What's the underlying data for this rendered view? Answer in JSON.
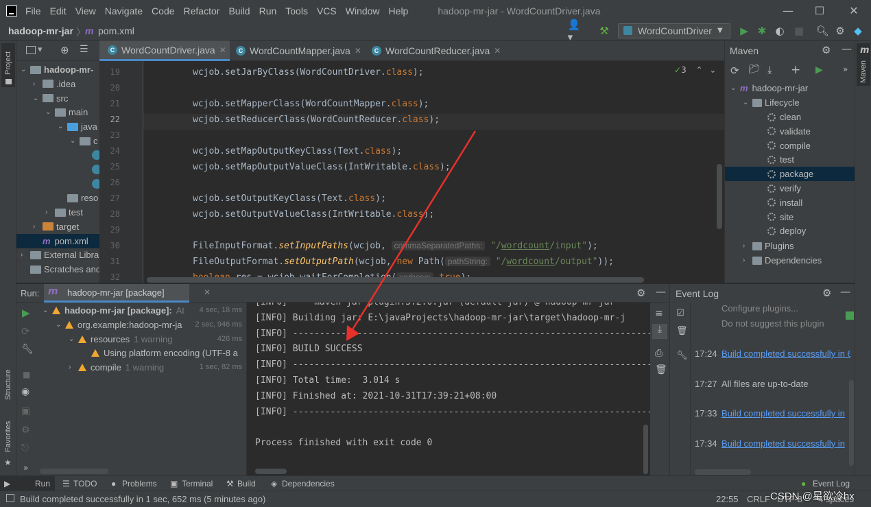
{
  "window": {
    "menu": [
      "File",
      "Edit",
      "View",
      "Navigate",
      "Code",
      "Refactor",
      "Build",
      "Run",
      "Tools",
      "VCS",
      "Window",
      "Help"
    ],
    "title": "hadoop-mr-jar - WordCountDriver.java"
  },
  "navbar": {
    "project": "hadoop-mr-jar",
    "separator": "〉",
    "file": "pom.xml",
    "run_config": "WordCountDriver"
  },
  "left_strip": {
    "project": "Project",
    "structure": "Structure",
    "favorites": "Favorites"
  },
  "project_tree": [
    {
      "label": "hadoop-mr-",
      "indent": 0,
      "arrow": "⌄",
      "kind": "project"
    },
    {
      "label": ".idea",
      "indent": 1,
      "arrow": "›",
      "kind": "folder"
    },
    {
      "label": "src",
      "indent": 1,
      "arrow": "⌄",
      "kind": "folder"
    },
    {
      "label": "main",
      "indent": 2,
      "arrow": "⌄",
      "kind": "folder"
    },
    {
      "label": "java",
      "indent": 3,
      "arrow": "⌄",
      "kind": "blue"
    },
    {
      "label": "c",
      "indent": 4,
      "arrow": "⌄",
      "kind": "package"
    },
    {
      "label": "",
      "indent": 5,
      "arrow": "",
      "kind": "class"
    },
    {
      "label": "",
      "indent": 5,
      "arrow": "",
      "kind": "class"
    },
    {
      "label": "",
      "indent": 5,
      "arrow": "",
      "kind": "class"
    },
    {
      "label": "reso",
      "indent": 3,
      "arrow": "",
      "kind": "folder"
    },
    {
      "label": "test",
      "indent": 2,
      "arrow": "›",
      "kind": "folder"
    },
    {
      "label": "target",
      "indent": 1,
      "arrow": "›",
      "kind": "orange"
    },
    {
      "label": "pom.xml",
      "indent": 1,
      "arrow": "",
      "kind": "maven"
    },
    {
      "label": "External Libra",
      "indent": 0,
      "arrow": "›",
      "kind": "lib"
    },
    {
      "label": "Scratches and",
      "indent": 0,
      "arrow": "",
      "kind": "scratch"
    }
  ],
  "tabs": [
    {
      "label": "WordCountDriver.java",
      "active": true
    },
    {
      "label": "WordCountMapper.java",
      "active": false
    },
    {
      "label": "WordCountReducer.java",
      "active": false
    }
  ],
  "editor": {
    "inspection_count": "3",
    "line_numbers": [
      "19",
      "20",
      "21",
      "22",
      "23",
      "24",
      "25",
      "26",
      "27",
      "28",
      "29",
      "30",
      "31",
      "32"
    ],
    "current_line": "22",
    "lines": {
      "l19": [
        "wcjob.setJarByClass(WordCountDriver.",
        "class",
        ");"
      ],
      "l21": [
        "wcjob.setMapperClass(WordCountMapper.",
        "class",
        ");"
      ],
      "l22": [
        "wcjob.setReducerClass(WordCountReducer.",
        "class",
        ");"
      ],
      "l24": [
        "wcjob.setMapOutputKeyClass(Text.",
        "class",
        ");"
      ],
      "l25": [
        "wcjob.setMapOutputValueClass(IntWritable.",
        "class",
        ");"
      ],
      "l27": [
        "wcjob.setOutputKeyClass(Text.",
        "class",
        ");"
      ],
      "l28": [
        "wcjob.setOutputValueClass(IntWritable.",
        "class",
        ");"
      ],
      "l30": {
        "a": "FileInputFormat.",
        "m": "setInputPaths",
        "b": "(wcjob, ",
        "hint": "commaSeparatedPaths:",
        "s1": "\"/",
        "u": "wordcount",
        "s2": "/input\"",
        "c": ");"
      },
      "l31": {
        "a": "FileOutputFormat.",
        "m": "setOutputPath",
        "b": "(wcjob, ",
        "kw": "new",
        "b2": " Path(",
        "hint": "pathString:",
        "s1": "\"/",
        "u": "wordcount",
        "s2": "/output\"",
        "c": "));"
      },
      "l32": {
        "kw": "boolean",
        "a": " res = wcjob.waitForCompletion(",
        "hint": "verbose:",
        "kw2": "true",
        "c": ");"
      }
    }
  },
  "maven": {
    "title": "Maven",
    "strip_label": "Maven",
    "project": "hadoop-mr-jar",
    "lifecycle": "Lifecycle",
    "goals": [
      "clean",
      "validate",
      "compile",
      "test",
      "package",
      "verify",
      "install",
      "site",
      "deploy"
    ],
    "selected_goal": "package",
    "plugins": "Plugins",
    "dependencies": "Dependencies"
  },
  "run": {
    "label": "Run:",
    "tab": "hadoop-mr-jar [package]",
    "tree": [
      {
        "label": "hadoop-mr-jar [package]:",
        "suffix": "At",
        "time": "4 sec, 18 ms",
        "indent": 0,
        "bold": true
      },
      {
        "label": "org.example:hadoop-mr-ja",
        "suffix": "",
        "time": "2 sec, 946 ms",
        "indent": 1
      },
      {
        "label": "resources",
        "suffix": "1 warning",
        "time": "426 ms",
        "indent": 2
      },
      {
        "label": "Using platform encoding (UTF-8 a",
        "suffix": "",
        "time": "",
        "indent": 3
      },
      {
        "label": "compile",
        "suffix": "1 warning",
        "time": "1 sec, 82 ms",
        "indent": 2
      }
    ],
    "console": [
      "[INFO] --- maven-jar-plugin:3.2.0:jar (default-jar) @ hadoop-mr-jar",
      "[INFO] Building jar: E:\\javaProjects\\hadoop-mr-jar\\target\\hadoop-mr-j",
      "[INFO] ------------------------------------------------------------------------",
      "[INFO] BUILD SUCCESS",
      "[INFO] ------------------------------------------------------------------------",
      "[INFO] Total time:  3.014 s",
      "[INFO] Finished at: 2021-10-31T17:39:21+08:00",
      "[INFO] ------------------------------------------------------------------------",
      "",
      "Process finished with exit code 0"
    ]
  },
  "event_log": {
    "title": "Event Log",
    "configure": "Configure plugins...",
    "dont_suggest": "Do not suggest this plugin",
    "entries": [
      {
        "time": "17:24",
        "text": "Build completed successfully in 6",
        "link": true
      },
      {
        "time": "17:27",
        "text": "All files are up-to-date",
        "link": false
      },
      {
        "time": "17:33",
        "text": "Build completed successfully in",
        "link": true
      },
      {
        "time": "17:34",
        "text": "Build completed successfully in",
        "link": true
      }
    ]
  },
  "tool_windows": [
    "Run",
    "TODO",
    "Problems",
    "Terminal",
    "Build",
    "Dependencies"
  ],
  "event_log_button": "Event Log",
  "status": {
    "message": "Build completed successfully in 1 sec, 652 ms (5 minutes ago)",
    "position": "22:55",
    "line_sep": "CRLF",
    "encoding": "UTF-8",
    "indent": "4 spaces",
    "watermark": "CSDN @星欲冷hx"
  },
  "colors": {
    "accent_selection": "#0d293e",
    "link": "#589df6",
    "warning": "#f0a732",
    "run_green": "#499c54"
  }
}
